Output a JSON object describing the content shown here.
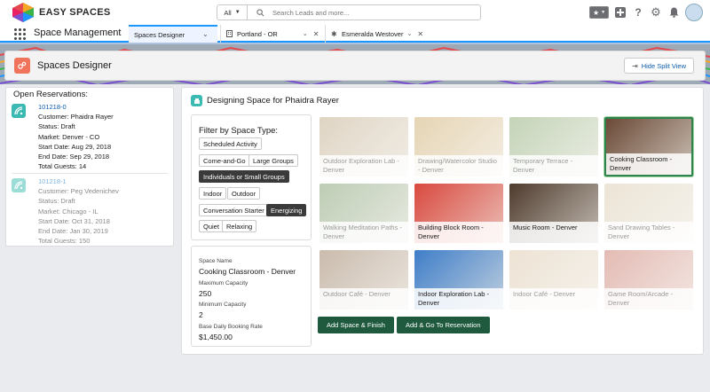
{
  "brand": {
    "name": "EASY SPACES"
  },
  "search": {
    "scope": "All",
    "placeholder": "Search Leads and more..."
  },
  "nav": {
    "app_name": "Space Management",
    "tabs": [
      {
        "label": "Spaces Designer",
        "active": true
      },
      {
        "label": "Portland - OR",
        "active": false
      },
      {
        "label": "Esmeralda Westover",
        "active": false
      }
    ]
  },
  "page": {
    "title": "Spaces Designer",
    "hide_split_label": "Hide Split View"
  },
  "reservations": {
    "title": "Open Reservations:",
    "items": [
      {
        "id": "101218-0",
        "customer": "Customer: Phaidra Rayer",
        "status": "Status: Draft",
        "market": "Market: Denver - CO",
        "start": "Start Date: Aug 29, 2018",
        "end": "End Date: Sep 29, 2018",
        "guests": "Total Guests: 14"
      },
      {
        "id": "101218-1",
        "customer": "Customer: Peg Vedenichev",
        "status": "Status: Draft",
        "market": "Market: Chicago - IL",
        "start": "Start Date: Oct 31, 2018",
        "end": "End Date: Jan 30, 2019",
        "guests": "Total Guests: 150"
      }
    ]
  },
  "designer": {
    "title": "Designing Space for Phaidra Rayer",
    "filter_title": "Filter by Space Type:",
    "filters": [
      {
        "label": "Scheduled Activity",
        "selected": false
      },
      {
        "label": "Come-and-Go",
        "selected": false
      },
      {
        "label": "Large Groups",
        "selected": false
      },
      {
        "label": "Individuals or Small Groups",
        "selected": true
      },
      {
        "label": "Indoor",
        "selected": false
      },
      {
        "label": "Outdoor",
        "selected": false
      },
      {
        "label": "Conversation Starter",
        "selected": false
      },
      {
        "label": "Energizing",
        "selected": true
      },
      {
        "label": "Quiet",
        "selected": false
      },
      {
        "label": "Relaxing",
        "selected": false
      }
    ],
    "details": {
      "name_label": "Space Name",
      "name_value": "Cooking Classroom - Denver",
      "max_label": "Maximum Capacity",
      "max_value": "250",
      "min_label": "Minimum Capacity",
      "min_value": "2",
      "rate_label": "Base Daily Booking Rate",
      "rate_value": "$1,450.00"
    },
    "spaces": [
      {
        "name": "Outdoor Exploration Lab - Denver",
        "state": "faded",
        "color": "#b9a27d"
      },
      {
        "name": "Drawing/Watercolor Studio - Denver",
        "state": "faded",
        "color": "#c9a35c"
      },
      {
        "name": "Temporary Terrace - Denver",
        "state": "faded",
        "color": "#7fa063"
      },
      {
        "name": "Cooking Classroom - Denver",
        "state": "selected",
        "color": "#6b4a37"
      },
      {
        "name": "Walking Meditation Paths - Denver",
        "state": "faded",
        "color": "#6f8f5a"
      },
      {
        "name": "Building Block Room - Denver",
        "state": "active",
        "color": "#d9493f"
      },
      {
        "name": "Music Room - Denver",
        "state": "active",
        "color": "#4e3b2d"
      },
      {
        "name": "Sand Drawing Tables - Denver",
        "state": "faded",
        "color": "#d6c6a6"
      },
      {
        "name": "Outdoor Café - Denver",
        "state": "faded",
        "color": "#8a6a4a"
      },
      {
        "name": "Indoor Exploration Lab - Denver",
        "state": "active",
        "color": "#3f7ec8"
      },
      {
        "name": "Indoor Café - Denver",
        "state": "faded",
        "color": "#d9c2a2"
      },
      {
        "name": "Game Room/Arcade - Denver",
        "state": "faded",
        "color": "#c46a5a"
      }
    ],
    "buttons": {
      "finish": "Add Space & Finish",
      "go": "Add & Go To Reservation"
    }
  }
}
